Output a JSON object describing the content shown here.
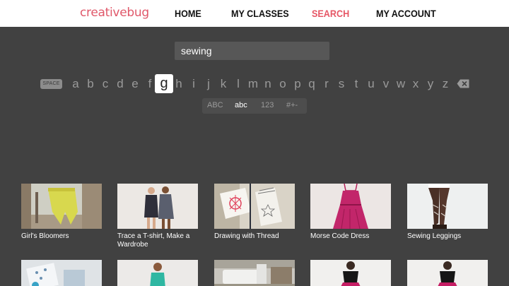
{
  "app": {
    "logo_text": "creativebug"
  },
  "nav": {
    "items": [
      {
        "label": "HOME",
        "active": false
      },
      {
        "label": "MY CLASSES",
        "active": false
      },
      {
        "label": "SEARCH",
        "active": true
      },
      {
        "label": "MY ACCOUNT",
        "active": false
      }
    ],
    "active_color": "#e65766"
  },
  "search": {
    "value": "sewing"
  },
  "keyboard": {
    "space_label": "SPACE",
    "letters": [
      "a",
      "b",
      "c",
      "d",
      "e",
      "f",
      "g",
      "h",
      "i",
      "j",
      "k",
      "l",
      "m",
      "n",
      "o",
      "p",
      "q",
      "r",
      "s",
      "t",
      "u",
      "v",
      "w",
      "x",
      "y",
      "z"
    ],
    "focused_key": "g",
    "backspace_icon": "backspace-icon",
    "modes": [
      "ABC",
      "abc",
      "123",
      "#+-"
    ],
    "selected_mode": "abc"
  },
  "results": {
    "row1": [
      {
        "title": "Girl's Bloomers"
      },
      {
        "title": "Trace a T-shirt, Make a Wardrobe"
      },
      {
        "title": "Drawing with Thread"
      },
      {
        "title": "Morse Code Dress"
      },
      {
        "title": "Sewing Leggings"
      }
    ],
    "row2": [
      {
        "title": ""
      },
      {
        "title": ""
      },
      {
        "title": ""
      },
      {
        "title": ""
      },
      {
        "title": ""
      }
    ]
  },
  "colors": {
    "background": "#414141",
    "brand": "#e0586a"
  }
}
